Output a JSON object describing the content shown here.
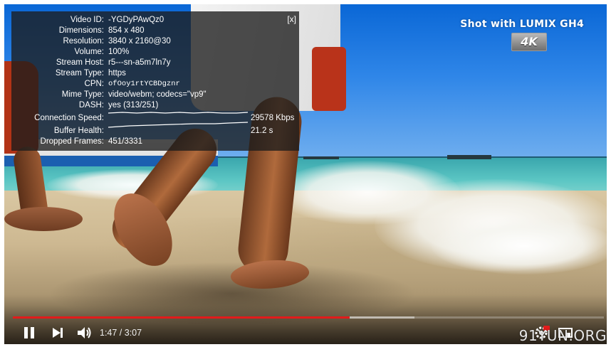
{
  "watermark": {
    "shot_with": "Shot with LUMIX GH4",
    "badge": "4K"
  },
  "stats": {
    "close": "[x]",
    "rows": [
      {
        "label": "Video ID:",
        "value": "-YGDyPAwQz0"
      },
      {
        "label": "Dimensions:",
        "value": "854 x 480"
      },
      {
        "label": "Resolution:",
        "value": "3840 x 2160@30"
      },
      {
        "label": "Volume:",
        "value": "100%"
      },
      {
        "label": "Stream Host:",
        "value": "r5---sn-a5m7ln7y"
      },
      {
        "label": "Stream Type:",
        "value": "https"
      },
      {
        "label": "CPN:",
        "value": "ofOoy1rtYCBDgznr"
      },
      {
        "label": "Mime Type:",
        "value": "video/webm; codecs=\"vp9\""
      },
      {
        "label": "DASH:",
        "value": "yes (313/251)"
      }
    ],
    "connection_speed": {
      "label": "Connection Speed:",
      "value": "29578 Kbps"
    },
    "buffer_health": {
      "label": "Buffer Health:",
      "value": "21.2 s"
    },
    "dropped_frames": {
      "label": "Dropped Frames:",
      "value": "451/3331"
    }
  },
  "player": {
    "time": "1:47 / 3:07",
    "played_fraction": 0.57,
    "buffered_fraction": 0.68,
    "site_watermark": "91YUN.ORG",
    "colors": {
      "progress": "#e21b1b",
      "panel": "rgba(28,28,28,0.78)"
    }
  }
}
